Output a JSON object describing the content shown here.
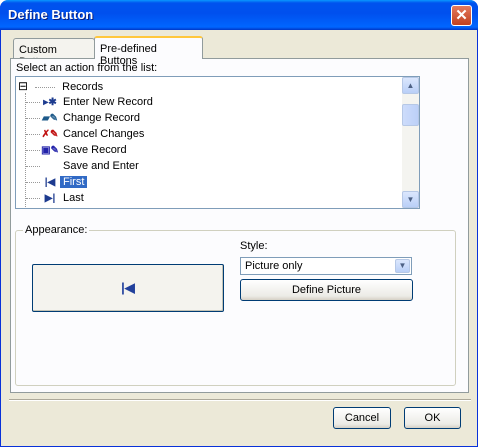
{
  "window": {
    "title": "Define Button",
    "close_glyph": "✕"
  },
  "tabs": [
    {
      "label": "Custom Button",
      "active": false
    },
    {
      "label": "Pre-defined Buttons",
      "active": true
    }
  ],
  "list": {
    "label": "Select an action from the list:",
    "root": {
      "expander": "⊟",
      "label": "Records"
    },
    "items": [
      {
        "icon": "new-record-icon",
        "glyph": "▸✱",
        "color": "#1d3b8f",
        "label": "Enter New Record",
        "selected": false
      },
      {
        "icon": "edit-record-icon",
        "glyph": "▰✎",
        "color": "#1e5a8a",
        "label": "Change Record",
        "selected": false
      },
      {
        "icon": "cancel-changes-icon",
        "glyph": "✗✎",
        "color": "#c01010",
        "label": "Cancel Changes",
        "selected": false
      },
      {
        "icon": "save-record-icon",
        "glyph": "▣✎",
        "color": "#2222aa",
        "label": "Save Record",
        "selected": false
      },
      {
        "icon": "",
        "glyph": "",
        "color": "#000000",
        "label": "Save and Enter",
        "selected": false
      },
      {
        "icon": "first-record-icon",
        "glyph": "|◀",
        "color": "#1d3b8f",
        "label": "First",
        "selected": true
      },
      {
        "icon": "last-record-icon",
        "glyph": "▶|",
        "color": "#1d3b8f",
        "label": "Last",
        "selected": false
      }
    ]
  },
  "appearance": {
    "label": "Appearance:",
    "preview_glyph": "|◀",
    "style_label": "Style:",
    "style_value": "Picture only",
    "define_picture": "Define Picture"
  },
  "footer": {
    "cancel": "Cancel",
    "ok": "OK"
  },
  "colors": {
    "selection": "#316ac5",
    "titlebar": "#0053ee"
  }
}
